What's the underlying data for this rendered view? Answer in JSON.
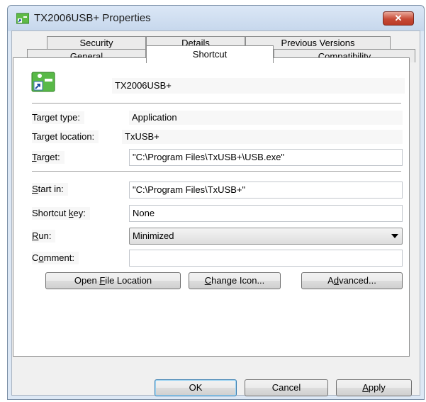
{
  "window": {
    "title": "TX2006USB+ Properties",
    "close_symbol": "✕",
    "accent_close": "#c74a36"
  },
  "tabs": {
    "row_back": [
      "Security",
      "Details",
      "Previous Versions"
    ],
    "row_front": [
      "General",
      "Shortcut",
      "Compatibility"
    ],
    "selected": "Shortcut"
  },
  "shortcut": {
    "name": "TX2006USB+",
    "icon": "shortcut-arrow-icon",
    "target_type": {
      "label": "Target type:",
      "value": "Application"
    },
    "target_location": {
      "label": "Target location:",
      "value": "TxUSB+"
    },
    "target": {
      "label_first": "T",
      "label_rest": "arget:",
      "value": "\"C:\\Program Files\\TxUSB+\\USB.exe\""
    },
    "start_in": {
      "label_first": "S",
      "label_rest": "tart in:",
      "value": "\"C:\\Program Files\\TxUSB+\""
    },
    "shortcut_key": {
      "label_before": "Shortcut ",
      "label_mn": "k",
      "label_after": "ey:",
      "value": "None"
    },
    "run": {
      "label_first": "R",
      "label_rest": "un:",
      "value": "Minimized"
    },
    "comment": {
      "label_before": "C",
      "label_mn": "o",
      "label_after": "mment:",
      "value": ""
    },
    "buttons": {
      "open_file_location": {
        "before": "Open ",
        "mn": "F",
        "after": "ile Location"
      },
      "change_icon": {
        "before": "",
        "mn": "C",
        "after": "hange Icon..."
      },
      "advanced": {
        "before": "A",
        "mn": "d",
        "after": "vanced..."
      }
    }
  },
  "dialog_buttons": {
    "ok": "OK",
    "cancel": "Cancel",
    "apply": {
      "mn": "A",
      "rest": "pply"
    }
  }
}
